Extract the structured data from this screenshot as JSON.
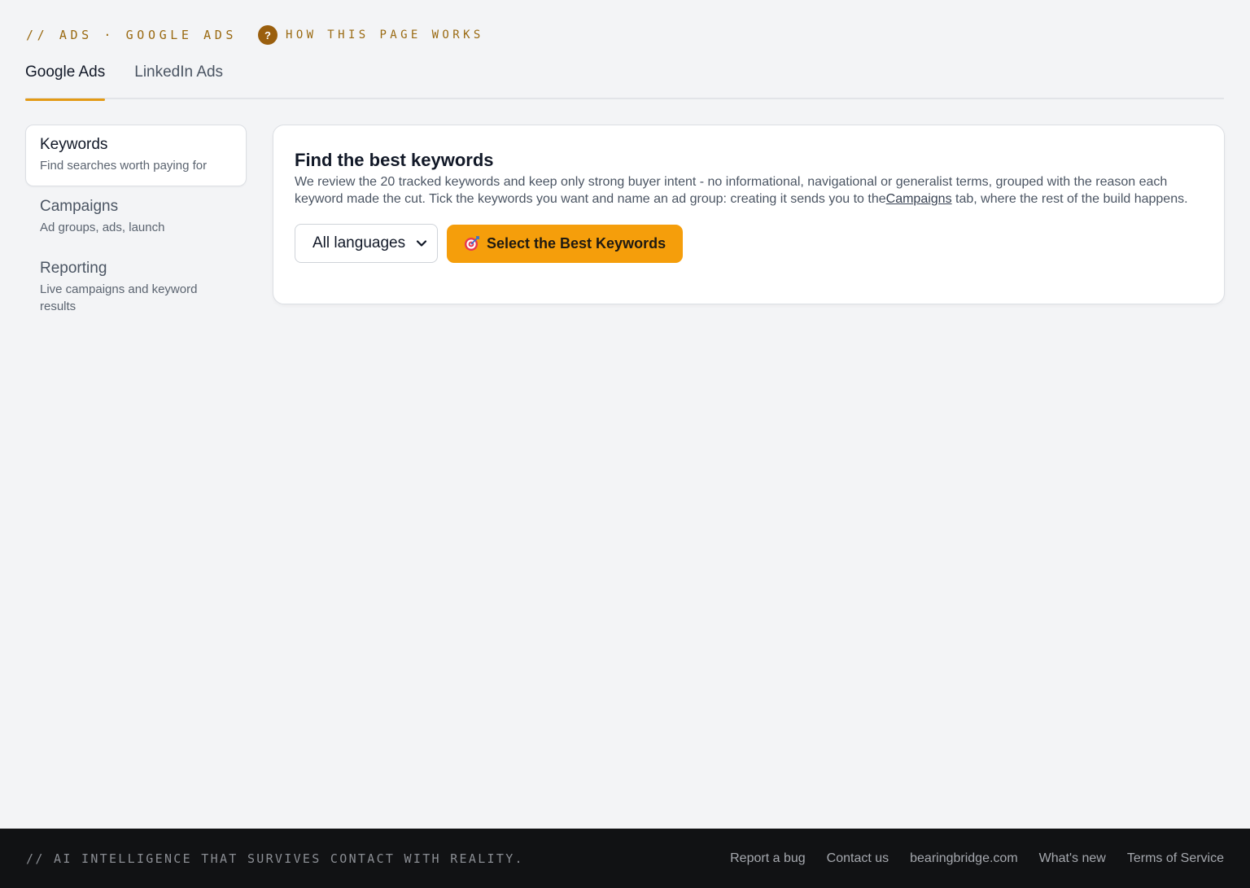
{
  "breadcrumb": {
    "text": "// ADS · GOOGLE ADS"
  },
  "help": {
    "icon": "question-icon",
    "glyph": "?",
    "label": "HOW THIS PAGE WORKS"
  },
  "tabs": [
    {
      "label": "Google Ads",
      "active": true
    },
    {
      "label": "LinkedIn Ads",
      "active": false
    }
  ],
  "sidenav": {
    "items": [
      {
        "title": "Keywords",
        "subtitle": "Find searches worth paying for",
        "active": true
      },
      {
        "title": "Campaigns",
        "subtitle": "Ad groups, ads, launch",
        "active": false
      },
      {
        "title": "Reporting",
        "subtitle": "Live campaigns and keyword results",
        "active": false
      }
    ]
  },
  "card": {
    "title": "Find the best keywords",
    "desc_before": "We review the 20 tracked keywords and keep only strong buyer intent - no informational, navigational or generalist terms, grouped with the reason each keyword made the cut. Tick the keywords you want and name an ad group: creating it sends you to the",
    "desc_link": "Campaigns",
    "desc_after": " tab, where the rest of the build happens.",
    "language_select": {
      "value": "All languages"
    },
    "primary_button": {
      "icon": "target-icon",
      "label": "Select the Best Keywords"
    }
  },
  "footer": {
    "tagline": "// AI INTELLIGENCE THAT SURVIVES CONTACT WITH REALITY.",
    "links": [
      "Report a bug",
      "Contact us",
      "bearingbridge.com",
      "What's new",
      "Terms of Service"
    ]
  },
  "colors": {
    "accent": "#f59e0b",
    "brand_text": "#9a6a12",
    "footer_bg": "#111214"
  }
}
